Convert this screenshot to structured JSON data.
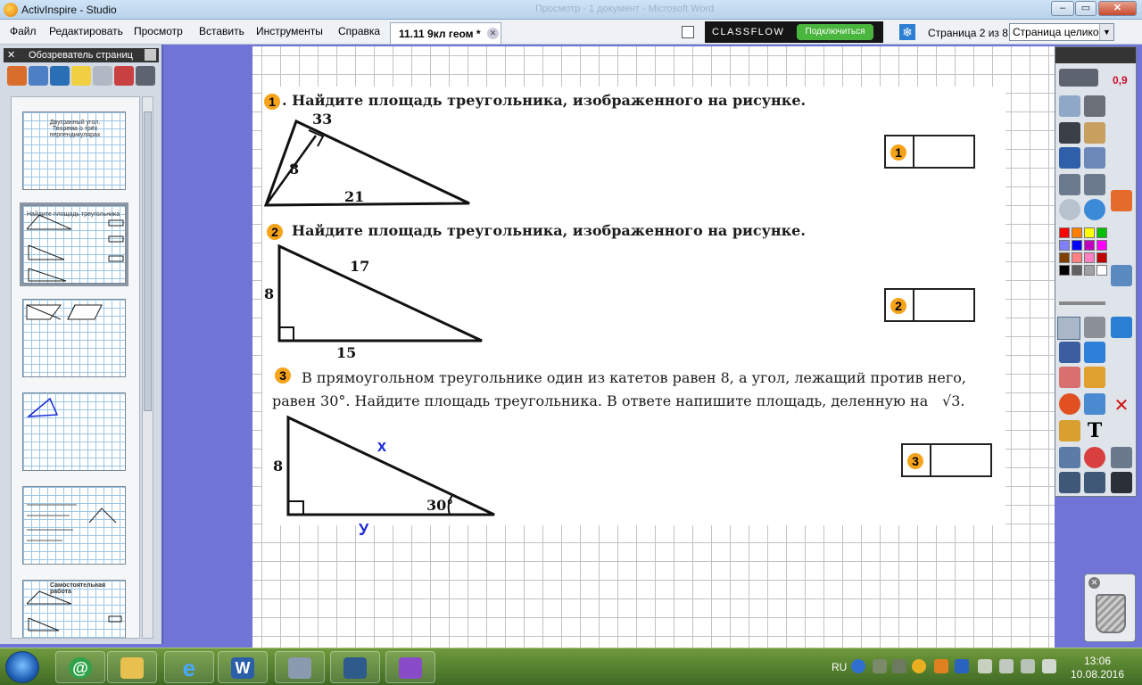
{
  "window": {
    "title": "ActivInspire - Studio",
    "faded_title": "Просмотр - 1 документ - Microsoft Word"
  },
  "menu": {
    "items": [
      "Файл",
      "Редактировать",
      "Просмотр",
      "Вставить",
      "Инструменты",
      "Справка"
    ],
    "doc_tab": "11.11 9кл геом *",
    "classflow_brand": "CLASSFLOW",
    "connect_label": "Подключиться",
    "page_counter": "Страница 2 из 8",
    "zoom_value": "Страница целиком"
  },
  "browser": {
    "title": "Обозреватель страниц",
    "thumbs": [
      {
        "text": "Двугранный угол. Теорема о трёх перпендикулярах"
      },
      {
        "text": "Найдите площадь треугольника"
      },
      {
        "text": ""
      },
      {
        "text": ""
      },
      {
        "text": ""
      },
      {
        "text": "Самостоятельная работа"
      }
    ]
  },
  "problems": [
    {
      "number": "1",
      "text": ". Найдите площадь треугольника, изображенного на рисунке.",
      "labels": {
        "top": "33",
        "side": "8",
        "base": "21"
      },
      "answer_number": "1"
    },
    {
      "number": "2",
      "text": "Найдите площадь треугольника, изображенного на рисунке.",
      "labels": {
        "hyp": "17",
        "leg": "8",
        "base": "15"
      },
      "answer_number": "2"
    },
    {
      "number": "3",
      "text_line1": "В прямоугольном треугольнике один из катетов равен 8, а угол, лежащий против него,",
      "text_line2": "равен 30°. Найдите площадь треугольника. В ответе напишите площадь, деленную на",
      "sqrt": "√3.",
      "labels": {
        "leg": "8",
        "angle": "30°",
        "hyp_hand": "х",
        "base_hand": "У"
      },
      "answer_number": "3"
    }
  ],
  "toolbox": {
    "zoom_value": "0,9",
    "colors": [
      "#ff0000",
      "#ff8000",
      "#ffff00",
      "#00c000",
      "#8080ff",
      "#0000ff",
      "#c000c0",
      "#ff00ff",
      "#804000",
      "#ff8080",
      "#ff80c0",
      "#c00000",
      "#000000",
      "#606060",
      "#a0a0a0",
      "#ffffff"
    ]
  },
  "taskbar": {
    "lang": "RU",
    "time": "13:06",
    "date": "10.08.2016"
  }
}
